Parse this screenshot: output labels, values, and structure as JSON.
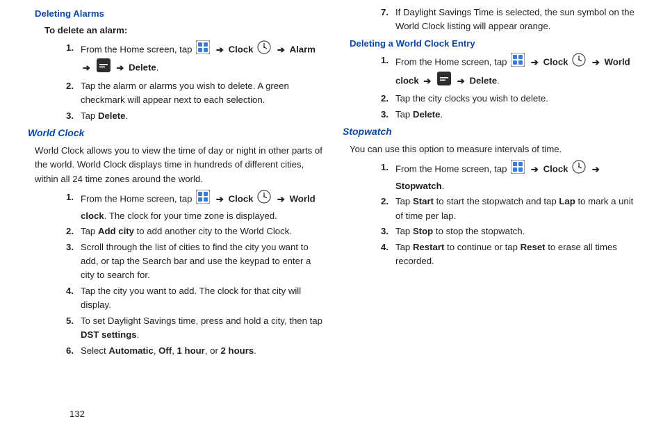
{
  "pageNumber": "132",
  "arrow": "➔",
  "col1": {
    "h1": "Deleting Alarms",
    "sub1": "To delete an alarm:",
    "s1_1a": "From the Home screen, tap ",
    "s1_1b": " Clock ",
    "s1_1c": " Alarm ",
    "s1_1d": " Delete",
    "s1_1e": ".",
    "s1_2": "Tap the alarm or alarms you wish to delete. A green checkmark will appear next to each selection.",
    "s1_3a": "Tap ",
    "s1_3b": "Delete",
    "s1_3c": ".",
    "h2": "World Clock",
    "intro2": "World Clock allows you to view the time of day or night in other parts of the world. World Clock displays time in hundreds of different cities, within all 24 time zones around the world.",
    "s2_1a": "From the Home screen, tap ",
    "s2_1b": " Clock ",
    "s2_1c": " World clock",
    "s2_1d": ". The clock for your time zone is displayed.",
    "s2_2a": "Tap ",
    "s2_2b": "Add city",
    "s2_2c": " to add another city to the World Clock.",
    "s2_3": "Scroll through the list of cities to find the city you want to add, or tap the Search bar and use the keypad to enter a city to search for.",
    "s2_4": "Tap the city you want to add. The clock for that city will display.",
    "s2_5a": "To set Daylight Savings time, press and hold a city, then tap ",
    "s2_5b": "DST settings",
    "s2_5c": ".",
    "s2_6a": "Select ",
    "s2_6b": "Automatic",
    "s2_6c": ", ",
    "s2_6d": "Off",
    "s2_6e": ", ",
    "s2_6f": "1 hour",
    "s2_6g": ", or ",
    "s2_6h": "2 hours",
    "s2_6i": "."
  },
  "col2": {
    "s0_7": "If Daylight Savings Time is selected, the sun symbol on the World Clock listing will appear orange.",
    "h3": "Deleting a World Clock Entry",
    "s3_1a": "From the Home screen, tap ",
    "s3_1b": " Clock ",
    "s3_1c": " World clock ",
    "s3_1d": " Delete",
    "s3_1e": ".",
    "s3_2": "Tap the city clocks you wish to delete.",
    "s3_3a": "Tap ",
    "s3_3b": "Delete",
    "s3_3c": ".",
    "h4": "Stopwatch",
    "intro4": "You can use this option to measure intervals of time.",
    "s4_1a": "From the Home screen, tap ",
    "s4_1b": " Clock ",
    "s4_1c": " Stopwatch",
    "s4_1d": ".",
    "s4_2a": "Tap ",
    "s4_2b": "Start",
    "s4_2c": " to start the stopwatch and tap ",
    "s4_2d": "Lap",
    "s4_2e": " to mark a unit of time per lap.",
    "s4_3a": "Tap ",
    "s4_3b": "Stop",
    "s4_3c": " to stop the stopwatch.",
    "s4_4a": "Tap ",
    "s4_4b": "Restart",
    "s4_4c": " to continue or tap ",
    "s4_4d": "Reset",
    "s4_4e": " to erase all times recorded."
  }
}
